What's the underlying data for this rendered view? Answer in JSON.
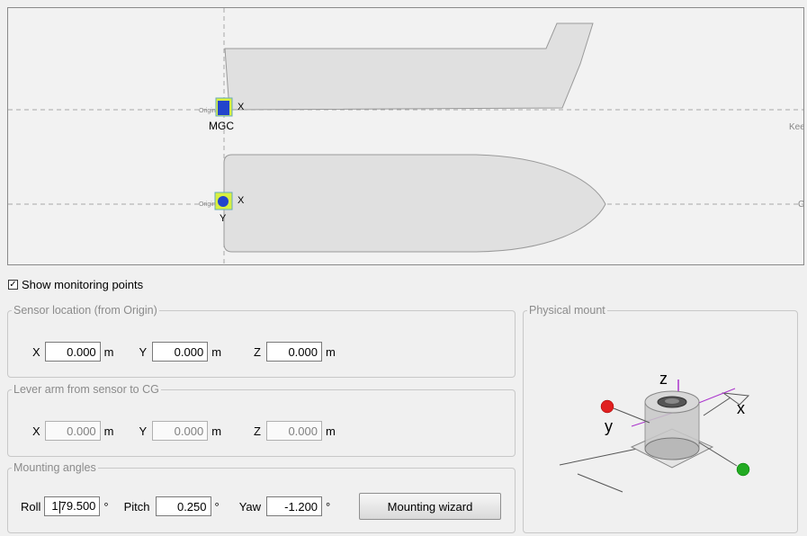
{
  "canvas": {
    "origin_label": "Origin",
    "mgc_label": "MGC",
    "axis_x": "X",
    "axis_y": "Y",
    "keel_label": "Kee",
    "center_label": "C"
  },
  "show_monitoring": {
    "label": "Show monitoring points",
    "checked": true,
    "mark": "✓"
  },
  "sensor_location": {
    "title": "Sensor location (from Origin)",
    "x_label": "X",
    "x_value": "0.000",
    "y_label": "Y",
    "y_value": "0.000",
    "z_label": "Z",
    "z_value": "0.000",
    "unit": "m"
  },
  "lever_arm": {
    "title": "Lever arm from sensor to CG",
    "x_label": "X",
    "x_value": "0.000",
    "y_label": "Y",
    "y_value": "0.000",
    "z_label": "Z",
    "z_value": "0.000",
    "unit": "m"
  },
  "mounting_angles": {
    "title": "Mounting angles",
    "roll_label": "Roll",
    "roll_value_pre": "1",
    "roll_value_post": "79.500",
    "pitch_label": "Pitch",
    "pitch_value": "0.250",
    "yaw_label": "Yaw",
    "yaw_value": "-1.200",
    "unit": "°",
    "wizard_button": "Mounting wizard"
  },
  "physical_mount": {
    "title": "Physical mount",
    "axis_z": "z",
    "axis_x": "x",
    "axis_y": "y"
  },
  "colors": {
    "sensor_blue": "#2244cc",
    "sensor_bg": "#d8f040",
    "ball_red": "#e02020",
    "ball_green": "#22aa22",
    "axis_purple": "#aa33cc"
  }
}
